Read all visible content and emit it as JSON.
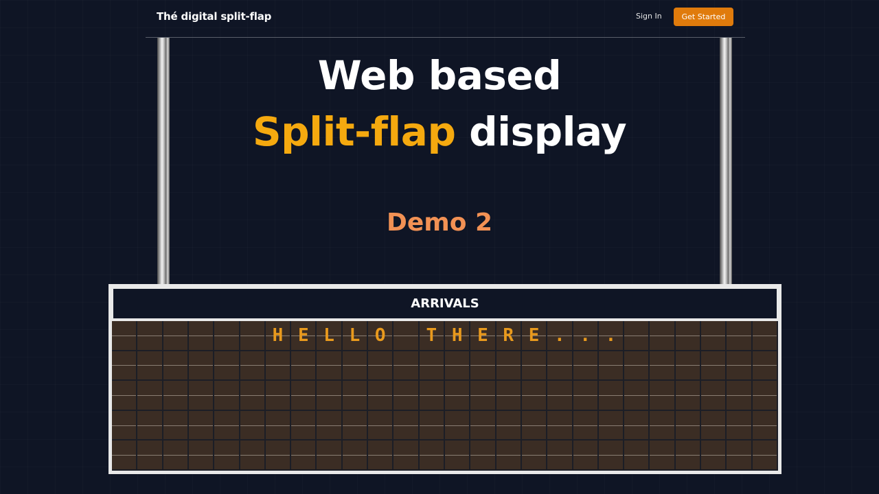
{
  "nav": {
    "brand": "Thé digital split-flap",
    "sign_in": "Sign In",
    "get_started": "Get Started"
  },
  "hero": {
    "line1": "Web based",
    "line2_accent": "Split-flap",
    "line2_rest": " display",
    "demo": "Demo 2"
  },
  "board": {
    "title": "ARRIVALS",
    "columns": 26,
    "rows": 5,
    "text_rows": [
      "      HELLO THERE...      ",
      "                          ",
      "                          ",
      "                          ",
      "                          "
    ]
  },
  "colors": {
    "background": "#0f1525",
    "accent_orange": "#e07b0c",
    "accent_yellow": "#f5a90f",
    "demo_color": "#f29154",
    "flap_text": "#e99a1d",
    "flap_bg": "#3b2d24"
  }
}
